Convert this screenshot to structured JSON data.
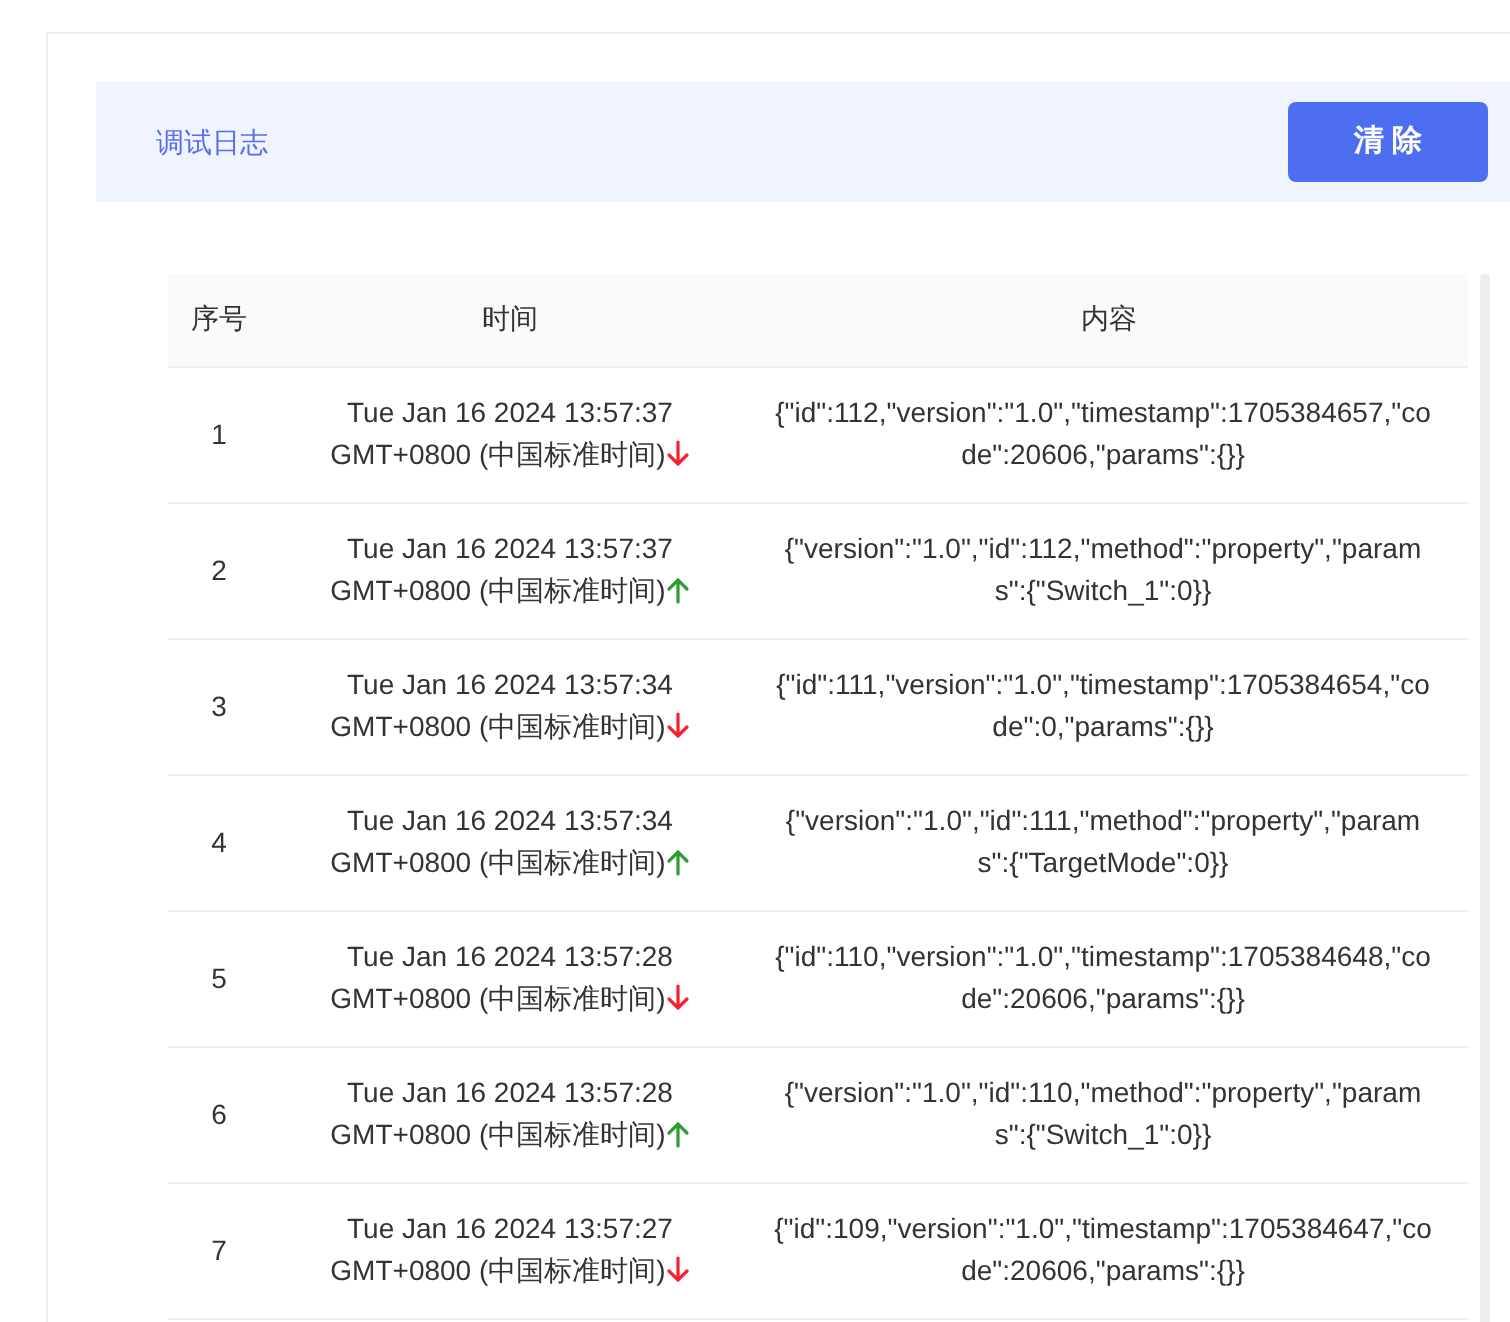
{
  "header": {
    "title": "调试日志",
    "clear_button": "清 除"
  },
  "table": {
    "columns": [
      "序号",
      "时间",
      "内容"
    ],
    "rows": [
      {
        "index": "1",
        "time": "Tue Jan 16 2024 13:57:37 GMT+0800 (中国标准时间)",
        "kind": "down",
        "content": "{\"id\":112,\"version\":\"1.0\",\"timestamp\":1705384657,\"code\":20606,\"params\":{}}"
      },
      {
        "index": "2",
        "time": "Tue Jan 16 2024 13:57:37 GMT+0800 (中国标准时间)",
        "kind": "up",
        "content": "{\"version\":\"1.0\",\"id\":112,\"method\":\"property\",\"params\":{\"Switch_1\":0}}"
      },
      {
        "index": "3",
        "time": "Tue Jan 16 2024 13:57:34 GMT+0800 (中国标准时间)",
        "kind": "down",
        "content": "{\"id\":111,\"version\":\"1.0\",\"timestamp\":1705384654,\"code\":0,\"params\":{}}"
      },
      {
        "index": "4",
        "time": "Tue Jan 16 2024 13:57:34 GMT+0800 (中国标准时间)",
        "kind": "up",
        "content": "{\"version\":\"1.0\",\"id\":111,\"method\":\"property\",\"params\":{\"TargetMode\":0}}"
      },
      {
        "index": "5",
        "time": "Tue Jan 16 2024 13:57:28 GMT+0800 (中国标准时间)",
        "kind": "down",
        "content": "{\"id\":110,\"version\":\"1.0\",\"timestamp\":1705384648,\"code\":20606,\"params\":{}}"
      },
      {
        "index": "6",
        "time": "Tue Jan 16 2024 13:57:28 GMT+0800 (中国标准时间)",
        "kind": "up",
        "content": "{\"version\":\"1.0\",\"id\":110,\"method\":\"property\",\"params\":{\"Switch_1\":0}}"
      },
      {
        "index": "7",
        "time": "Tue Jan 16 2024 13:57:27 GMT+0800 (中国标准时间)",
        "kind": "down",
        "content": "{\"id\":109,\"version\":\"1.0\",\"timestamp\":1705384647,\"code\":20606,\"params\":{}}"
      }
    ]
  }
}
